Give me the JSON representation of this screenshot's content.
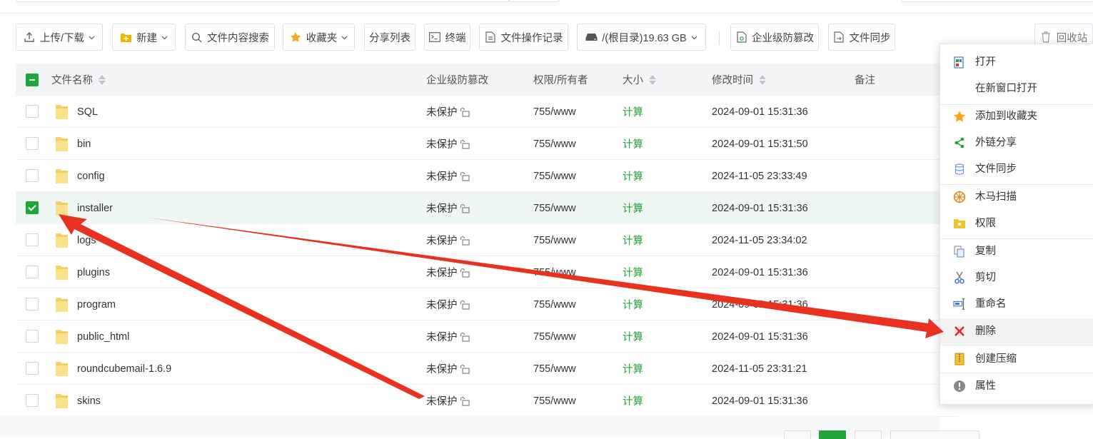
{
  "toolbar": {
    "upload_download": "上传/下载",
    "new": "新建",
    "content_search": "文件内容搜索",
    "favorites": "收藏夹",
    "share_list": "分享列表",
    "terminal": "终端",
    "operation_log": "文件操作记录",
    "disk": "/(根目录)19.63 GB",
    "tamper_proof": "企业级防篡改",
    "file_sync": "文件同步",
    "recycle_bin": "回收站"
  },
  "table": {
    "headers": {
      "name": "文件名称",
      "tamper": "企业级防篡改",
      "perm": "权限/所有者",
      "size": "大小",
      "mtime": "修改时间",
      "note": "备注"
    },
    "rows": [
      {
        "name": "SQL",
        "protect": "未保护",
        "perm": "755/www",
        "size": "计算",
        "mtime": "2024-09-01 15:31:36",
        "checked": false
      },
      {
        "name": "bin",
        "protect": "未保护",
        "perm": "755/www",
        "size": "计算",
        "mtime": "2024-09-01 15:31:50",
        "checked": false
      },
      {
        "name": "config",
        "protect": "未保护",
        "perm": "755/www",
        "size": "计算",
        "mtime": "2024-11-05 23:33:49",
        "checked": false
      },
      {
        "name": "installer",
        "protect": "未保护",
        "perm": "755/www",
        "size": "计算",
        "mtime": "2024-09-01 15:31:36",
        "checked": true
      },
      {
        "name": "logs",
        "protect": "未保护",
        "perm": "755/www",
        "size": "计算",
        "mtime": "2024-11-05 23:34:02",
        "checked": false
      },
      {
        "name": "plugins",
        "protect": "未保护",
        "perm": "755/www",
        "size": "计算",
        "mtime": "2024-09-01 15:31:36",
        "checked": false
      },
      {
        "name": "program",
        "protect": "未保护",
        "perm": "755/www",
        "size": "计算",
        "mtime": "2024-09-01 15:31:36",
        "checked": false
      },
      {
        "name": "public_html",
        "protect": "未保护",
        "perm": "755/www",
        "size": "计算",
        "mtime": "2024-09-01 15:31:36",
        "checked": false
      },
      {
        "name": "roundcubemail-1.6.9",
        "protect": "未保护",
        "perm": "755/www",
        "size": "计算",
        "mtime": "2024-11-05 23:31:21",
        "checked": false
      },
      {
        "name": "skins",
        "protect": "未保护",
        "perm": "755/www",
        "size": "计算",
        "mtime": "2024-09-01 15:31:36",
        "checked": false
      }
    ]
  },
  "context_menu": {
    "items": [
      {
        "label": "打开",
        "icon": "open-icon"
      },
      {
        "label": "在新窗口打开",
        "icon": ""
      },
      {
        "label": "添加到收藏夹",
        "icon": "star-icon"
      },
      {
        "label": "外链分享",
        "icon": "share-icon"
      },
      {
        "label": "文件同步",
        "icon": "sync-icon"
      },
      {
        "label": "木马扫描",
        "icon": "scan-icon"
      },
      {
        "label": "权限",
        "icon": "permission-icon"
      },
      {
        "label": "复制",
        "icon": "copy-icon"
      },
      {
        "label": "剪切",
        "icon": "scissors-icon"
      },
      {
        "label": "重命名",
        "icon": "rename-icon"
      },
      {
        "label": "删除",
        "icon": "delete-icon"
      },
      {
        "label": "创建压缩",
        "icon": "archive-icon"
      },
      {
        "label": "属性",
        "icon": "info-icon"
      }
    ],
    "highlighted": "删除"
  },
  "colors": {
    "accent": "#20a53a",
    "annotation_arrow": "#e8321f",
    "delete_icon": "#d9262c"
  }
}
